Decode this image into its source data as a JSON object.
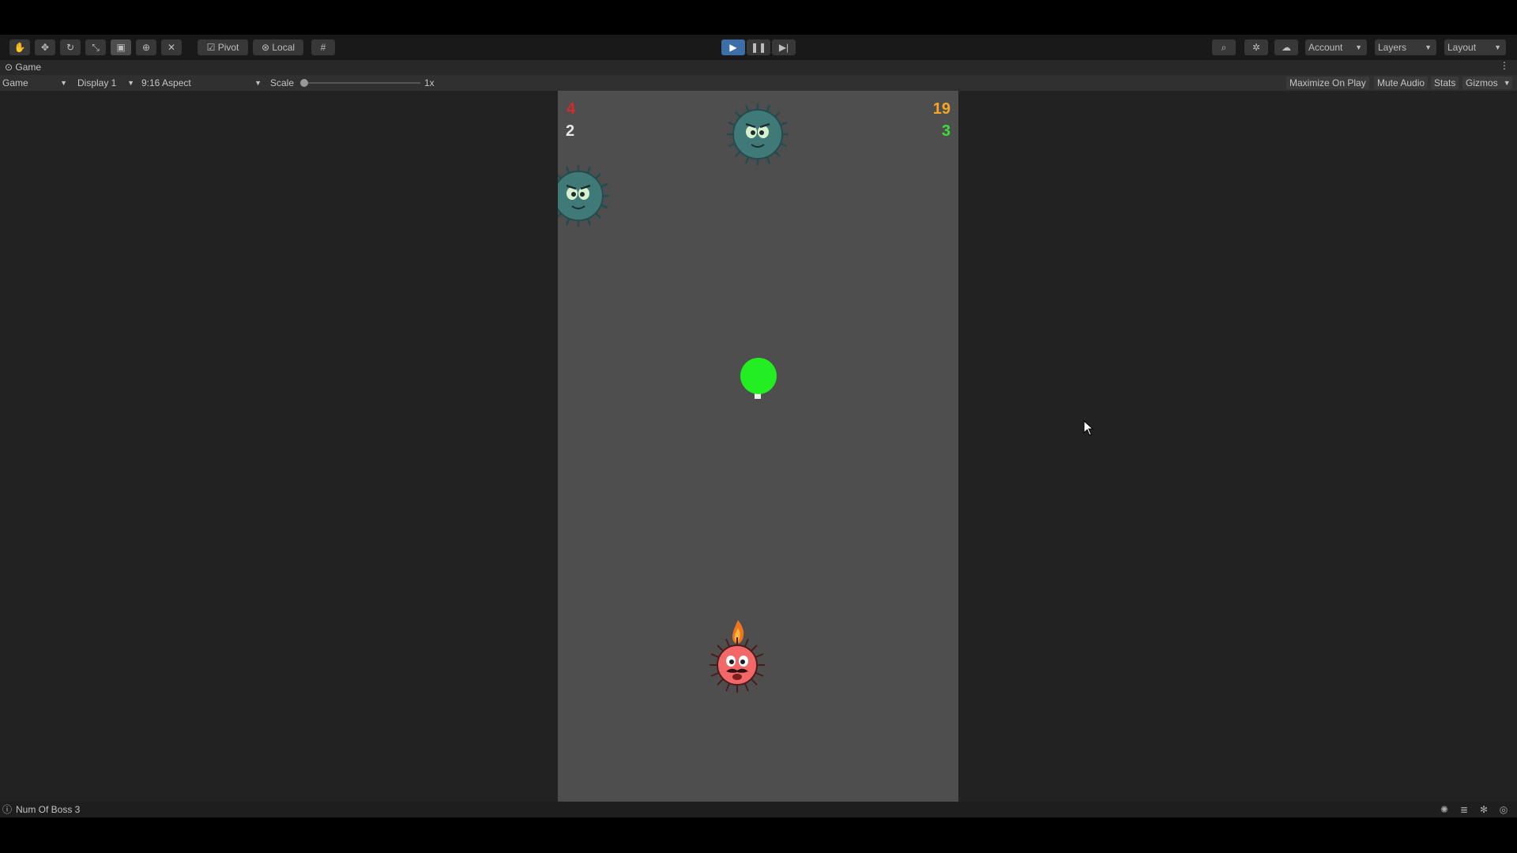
{
  "toolbar": {
    "pivot_label": "Pivot",
    "local_label": "Local",
    "account_label": "Account",
    "layers_label": "Layers",
    "layout_label": "Layout"
  },
  "tab": {
    "title": "Game"
  },
  "gamebar": {
    "mode": "Game",
    "display": "Display 1",
    "aspect": "9:16 Aspect",
    "scale_label": "Scale",
    "scale_value": "1x",
    "maximize_label": "Maximize On Play",
    "mute_label": "Mute Audio",
    "stats_label": "Stats",
    "gizmos_label": "Gizmos"
  },
  "hud": {
    "top_left_red": "4",
    "top_left_white": "2",
    "top_right_orange": "19",
    "top_right_green": "3"
  },
  "status": {
    "message": "Num Of Boss 3"
  },
  "colors": {
    "play_active": "#3c6ea8",
    "game_bg": "#4e4e4e",
    "hud_red": "#d42a2a",
    "hud_orange": "#f5a623",
    "hud_green": "#3ddc3d",
    "player_green": "#22ee22"
  },
  "icons": [
    "hand-icon",
    "move-icon",
    "rotate-icon",
    "scale-icon",
    "rect-icon",
    "transform-icon",
    "custom-tool-icon",
    "grid-icon",
    "play-icon",
    "pause-icon",
    "step-icon",
    "search-icon",
    "settings-icon",
    "cloud-icon",
    "eye-icon",
    "info-icon"
  ]
}
